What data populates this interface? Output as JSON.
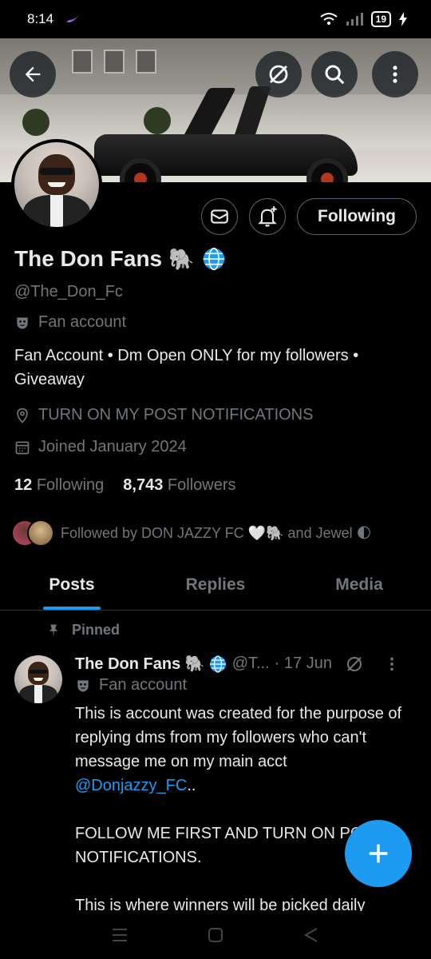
{
  "status_bar": {
    "time": "8:14",
    "battery": "19"
  },
  "header": {
    "back_icon": "arrow-left-icon",
    "grok_icon": "slashed-circle-icon",
    "search_icon": "search-icon",
    "more_icon": "more-vertical-icon"
  },
  "profile": {
    "name": "The Don Fans",
    "name_emoji": "🐘",
    "verified_icon": "globe-icon",
    "handle": "@The_Don_Fc",
    "label": "Fan account",
    "bio_line1": "Fan Account • Dm Open ONLY for my followers •",
    "bio_line2": "Giveaway",
    "location": "TURN ON MY POST NOTIFICATIONS",
    "joined": "Joined January 2024",
    "following_count": "12",
    "following_label": "Following",
    "followers_count": "8,743",
    "followers_label": "Followers",
    "followed_by": "Followed by DON JAZZY FC 🤍🐘 and Jewel 🌓",
    "follow_button": "Following"
  },
  "tabs": [
    {
      "label": "Posts"
    },
    {
      "label": "Replies"
    },
    {
      "label": "Media"
    }
  ],
  "post": {
    "pinned_label": "Pinned",
    "author": "The Don Fans 🐘",
    "handle_short": "@T...",
    "date": "· 17 Jun",
    "label": "Fan account",
    "text_part1": "This is account was created for the purpose of replying dms from my followers who can't message me on my main acct ",
    "mention": "@Donjazzy_FC",
    "text_part2": "..\n\nFOLLOW ME FIRST AND TURN ON POST NOTIFICATIONS.\n\nThis is where winners will be picked daily"
  },
  "colors": {
    "accent": "#1d9bf0",
    "background": "#000000",
    "muted": "#71767b"
  }
}
